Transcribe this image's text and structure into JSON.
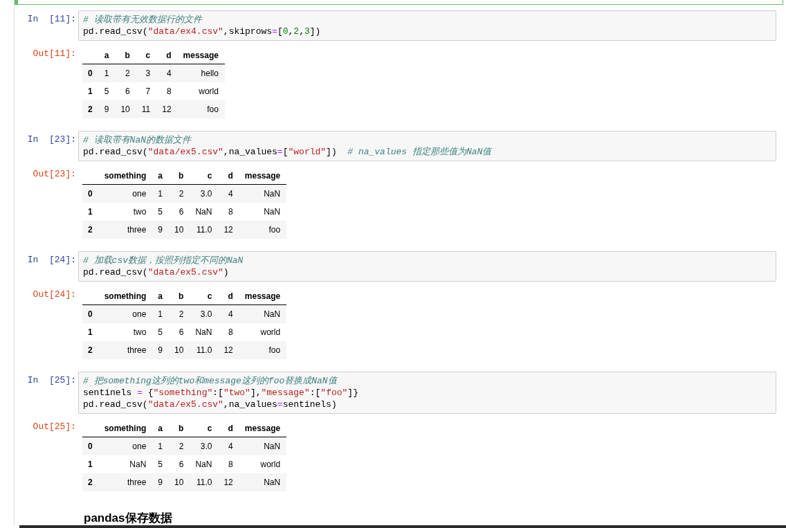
{
  "previous_cell": {
    "selected": true
  },
  "cells": [
    {
      "in_prompt": "In  [11]:",
      "code": [
        [
          {
            "kind": "comment",
            "text": "# 读取带有无效数据行的文件"
          }
        ],
        [
          {
            "kind": "plain",
            "text": "pd.read_csv("
          },
          {
            "kind": "string",
            "text": "\"data/ex4.csv\""
          },
          {
            "kind": "plain",
            "text": ",skiprows"
          },
          {
            "kind": "operator",
            "text": "="
          },
          {
            "kind": "plain",
            "text": "["
          },
          {
            "kind": "number",
            "text": "0"
          },
          {
            "kind": "plain",
            "text": ","
          },
          {
            "kind": "number",
            "text": "2"
          },
          {
            "kind": "plain",
            "text": ","
          },
          {
            "kind": "number",
            "text": "3"
          },
          {
            "kind": "plain",
            "text": "])"
          }
        ]
      ],
      "out_prompt": "Out[11]:",
      "table": {
        "columns": [
          "",
          "a",
          "b",
          "c",
          "d",
          "message"
        ],
        "rows": [
          [
            "0",
            "1",
            "2",
            "3",
            "4",
            "hello"
          ],
          [
            "1",
            "5",
            "6",
            "7",
            "8",
            "world"
          ],
          [
            "2",
            "9",
            "10",
            "11",
            "12",
            "foo"
          ]
        ]
      }
    },
    {
      "in_prompt": "In  [23]:",
      "code": [
        [
          {
            "kind": "comment",
            "text": "# 读取带有NaN的数据文件"
          }
        ],
        [
          {
            "kind": "plain",
            "text": "pd.read_csv("
          },
          {
            "kind": "string",
            "text": "\"data/ex5.csv\""
          },
          {
            "kind": "plain",
            "text": ",na_values"
          },
          {
            "kind": "operator",
            "text": "="
          },
          {
            "kind": "plain",
            "text": "["
          },
          {
            "kind": "string",
            "text": "\"world\""
          },
          {
            "kind": "plain",
            "text": "])  "
          },
          {
            "kind": "comment",
            "text": "# na_values 指定那些值为NaN值"
          }
        ]
      ],
      "out_prompt": "Out[23]:",
      "table": {
        "columns": [
          "",
          "something",
          "a",
          "b",
          "c",
          "d",
          "message"
        ],
        "rows": [
          [
            "0",
            "one",
            "1",
            "2",
            "3.0",
            "4",
            "NaN"
          ],
          [
            "1",
            "two",
            "5",
            "6",
            "NaN",
            "8",
            "NaN"
          ],
          [
            "2",
            "three",
            "9",
            "10",
            "11.0",
            "12",
            "foo"
          ]
        ]
      }
    },
    {
      "in_prompt": "In  [24]:",
      "code": [
        [
          {
            "kind": "comment",
            "text": "# 加载csv数据，按照列指定不同的NaN"
          }
        ],
        [
          {
            "kind": "plain",
            "text": "pd.read_csv("
          },
          {
            "kind": "string",
            "text": "\"data/ex5.csv\""
          },
          {
            "kind": "plain",
            "text": ")"
          }
        ]
      ],
      "out_prompt": "Out[24]:",
      "table": {
        "columns": [
          "",
          "something",
          "a",
          "b",
          "c",
          "d",
          "message"
        ],
        "rows": [
          [
            "0",
            "one",
            "1",
            "2",
            "3.0",
            "4",
            "NaN"
          ],
          [
            "1",
            "two",
            "5",
            "6",
            "NaN",
            "8",
            "world"
          ],
          [
            "2",
            "three",
            "9",
            "10",
            "11.0",
            "12",
            "foo"
          ]
        ]
      }
    },
    {
      "in_prompt": "In  [25]:",
      "code": [
        [
          {
            "kind": "comment",
            "text": "# 把something这列的two和message这列的foo替换成NaN值"
          }
        ],
        [
          {
            "kind": "plain",
            "text": "sentinels "
          },
          {
            "kind": "operator",
            "text": "="
          },
          {
            "kind": "plain",
            "text": " {"
          },
          {
            "kind": "string",
            "text": "\"something\""
          },
          {
            "kind": "plain",
            "text": ":["
          },
          {
            "kind": "string",
            "text": "\"two\""
          },
          {
            "kind": "plain",
            "text": "],"
          },
          {
            "kind": "string",
            "text": "\"message\""
          },
          {
            "kind": "plain",
            "text": ":["
          },
          {
            "kind": "string",
            "text": "\"foo\""
          },
          {
            "kind": "plain",
            "text": "]}"
          }
        ],
        [
          {
            "kind": "plain",
            "text": "pd.read_csv("
          },
          {
            "kind": "string",
            "text": "\"data/ex5.csv\""
          },
          {
            "kind": "plain",
            "text": ",na_values"
          },
          {
            "kind": "operator",
            "text": "="
          },
          {
            "kind": "plain",
            "text": "sentinels)"
          }
        ]
      ],
      "out_prompt": "Out[25]:",
      "table": {
        "columns": [
          "",
          "something",
          "a",
          "b",
          "c",
          "d",
          "message"
        ],
        "rows": [
          [
            "0",
            "one",
            "1",
            "2",
            "3.0",
            "4",
            "NaN"
          ],
          [
            "1",
            "NaN",
            "5",
            "6",
            "NaN",
            "8",
            "world"
          ],
          [
            "2",
            "three",
            "9",
            "10",
            "11.0",
            "12",
            "NaN"
          ]
        ]
      }
    }
  ],
  "heading": "pandas保存数据"
}
